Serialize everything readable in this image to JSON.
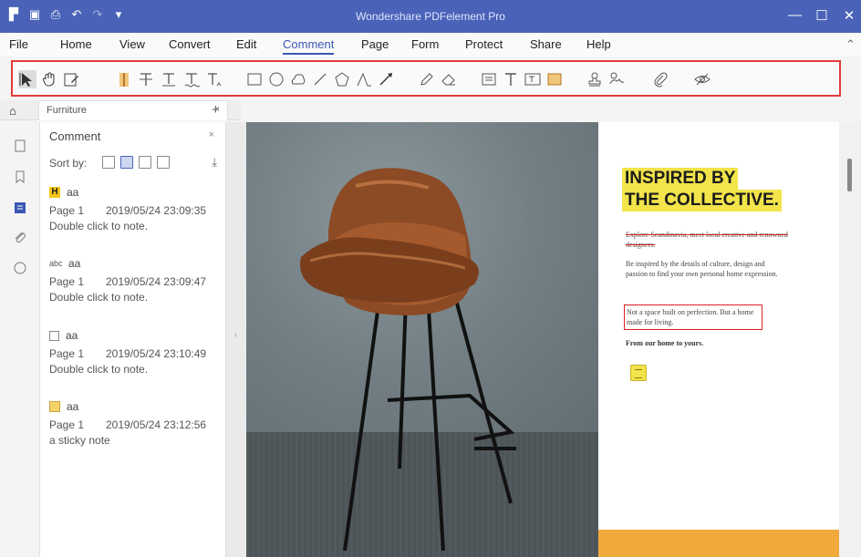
{
  "window": {
    "title": "Wondershare PDFelement Pro",
    "controls": [
      "—",
      "☐",
      "✕"
    ]
  },
  "quick_access": [
    "app-logo-icon",
    "save-icon",
    "print-icon",
    "undo-icon",
    "redo-icon",
    "customize-icon"
  ],
  "menu": {
    "items": [
      "File",
      "Home",
      "View",
      "Convert",
      "Edit",
      "Comment",
      "Page",
      "Form",
      "Protect",
      "Share",
      "Help"
    ],
    "active": "Comment",
    "collapse": "⌃"
  },
  "toolbar": {
    "tools": [
      "select-icon",
      "hand-icon",
      "edit-text-icon",
      "highlight-icon",
      "strikethrough-icon",
      "underline-icon",
      "squiggly-icon",
      "insert-text-icon",
      "rectangle-icon",
      "oval-icon",
      "cloud-icon",
      "line-icon",
      "polygon-icon",
      "polyline-icon",
      "arrow-icon",
      "pencil-icon",
      "eraser-icon",
      "note-icon",
      "typewriter-icon",
      "text-box-icon",
      "area-highlight-icon",
      "stamp-icon",
      "signature-icon",
      "attachment-icon",
      "hide-annotations-icon"
    ]
  },
  "tabs": {
    "home_icon": "home-icon",
    "document": "Furniture",
    "close": "×",
    "add": "+"
  },
  "panel": {
    "title": "Comment",
    "close": "×",
    "sort_label": "Sort by:",
    "comments": [
      {
        "type": "highlight",
        "icon_label": "H",
        "author": "aa",
        "page": "Page 1",
        "date": "2019/05/24 23:09:35",
        "note": "Double click to note."
      },
      {
        "type": "strikethrough",
        "icon_label": "abc",
        "author": "aa",
        "page": "Page 1",
        "date": "2019/05/24 23:09:47",
        "note": "Double click to note."
      },
      {
        "type": "rectangle",
        "icon_label": "",
        "author": "aa",
        "page": "Page 1",
        "date": "2019/05/24 23:10:49",
        "note": "Double click to note."
      },
      {
        "type": "sticky-note",
        "icon_label": "",
        "author": "aa",
        "page": "Page 1",
        "date": "2019/05/24 23:12:56",
        "note": "a sticky note"
      }
    ]
  },
  "document": {
    "headline_line1": "INSPIRED BY",
    "headline_line2": "THE COLLECTIVE.",
    "strike_text": "Explore Scandinavia, meet local creative and renowned designers.",
    "paragraph": "Be inspired by the details of culture, design and passion to find your own personal home expression.",
    "boxed_text": "Not a space built on perfection. But a home made for living.",
    "tagline": "From our home to yours."
  },
  "colors": {
    "titlebar": "#4a63b8",
    "accent": "#3b56b3",
    "highlight": "#f2e44a",
    "annotation_red": "#d22",
    "band": "#f1a93c"
  }
}
